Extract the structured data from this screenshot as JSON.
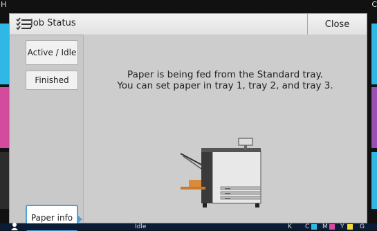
{
  "background": {
    "top_left_letter": "H",
    "top_right_letter": "C",
    "strip_colors": [
      "#2fb8e6",
      "#d24b9c",
      "#2c2c2c"
    ],
    "strip_colors_right": [
      "#2fb8e6",
      "#9a4fb3",
      "#2fb8e6"
    ]
  },
  "dialog": {
    "title": "Job Status",
    "close_label": "Close"
  },
  "tabs": {
    "active_idle": "Active / Idle",
    "finished": "Finished",
    "paper_info": "Paper info"
  },
  "message": {
    "line1": "Paper is being fed from the Standard tray.",
    "line2": "You can set paper in tray 1, tray 2, and tray 3."
  },
  "statusbar": {
    "status": "Idle",
    "inks": [
      "K",
      "C",
      "M",
      "Y",
      "G"
    ],
    "ink_colors": {
      "K": "#222222",
      "C": "#2fb8e6",
      "M": "#d24b9c",
      "Y": "#f0d83a",
      "G": "#888888"
    }
  },
  "icons": {
    "title": "job-list-icon",
    "printer": "printer-illustration",
    "user": "user-icon"
  }
}
